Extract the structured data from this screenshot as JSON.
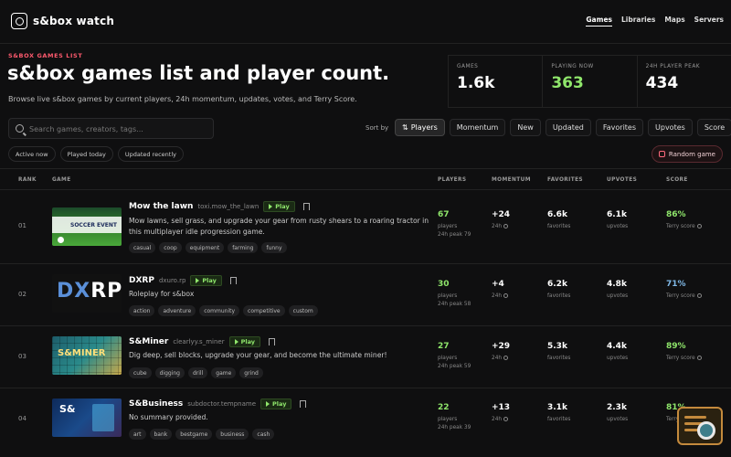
{
  "nav": {
    "brand": "s&box watch",
    "links": [
      "Games",
      "Libraries",
      "Maps",
      "Servers"
    ]
  },
  "hero": {
    "eyebrow": "S&BOX GAMES LIST",
    "title": "s&box games list and player count.",
    "subtitle": "Browse live s&box games by current players, 24h momentum, updates, votes, and Terry Score."
  },
  "stats": [
    {
      "label": "GAMES",
      "value": "1.6k"
    },
    {
      "label": "PLAYING NOW",
      "value": "363"
    },
    {
      "label": "24H PLAYER PEAK",
      "value": "434"
    }
  ],
  "search": {
    "placeholder": "Search games, creators, tags..."
  },
  "sort": {
    "label": "Sort by",
    "options": [
      "Players",
      "Momentum",
      "New",
      "Updated",
      "Favorites",
      "Upvotes",
      "Score"
    ],
    "active": "Players"
  },
  "filters": [
    "Active now",
    "Played today",
    "Updated recently"
  ],
  "random_label": "Random game",
  "columns": [
    "RANK",
    "GAME",
    "PLAYERS",
    "MOMENTUM",
    "FAVORITES",
    "UPVOTES",
    "SCORE"
  ],
  "rows": [
    {
      "rank": "01",
      "name": "Mow the lawn",
      "slug": "toxi.mow_the_lawn",
      "play": "Play",
      "thumb_text": "SOCCER EVENT",
      "desc": "Mow lawns, sell grass, and upgrade your gear from rusty shears to a roaring tractor in this multiplayer idle progression game.",
      "tags": [
        "casual",
        "coop",
        "equipment",
        "farming",
        "funny"
      ],
      "players": "67",
      "players_label": "players",
      "peak": "24h peak 79",
      "momentum": "+24",
      "momentum_label": "24h",
      "favorites": "6.6k",
      "favorites_label": "favorites",
      "upvotes": "6.1k",
      "upvotes_label": "upvotes",
      "score": "86%",
      "score_label": "Terry score",
      "score_color": "#8fe66b"
    },
    {
      "rank": "02",
      "name": "DXRP",
      "slug": "dxuro.rp",
      "play": "Play",
      "thumb_text": "DXRP",
      "desc": "Roleplay for s&box",
      "tags": [
        "action",
        "adventure",
        "community",
        "competitive",
        "custom"
      ],
      "players": "30",
      "players_label": "players",
      "peak": "24h peak 58",
      "momentum": "+4",
      "momentum_label": "24h",
      "favorites": "6.2k",
      "favorites_label": "favorites",
      "upvotes": "4.8k",
      "upvotes_label": "upvotes",
      "score": "71%",
      "score_label": "Terry score",
      "score_color": "#7fb8e6"
    },
    {
      "rank": "03",
      "name": "S&Miner",
      "slug": "clearlyy.s_miner",
      "play": "Play",
      "thumb_text": "S&MINER",
      "desc": "Dig deep, sell blocks, upgrade your gear, and become the ultimate miner!",
      "tags": [
        "cube",
        "digging",
        "drill",
        "game",
        "grind"
      ],
      "players": "27",
      "players_label": "players",
      "peak": "24h peak 59",
      "momentum": "+29",
      "momentum_label": "24h",
      "favorites": "5.3k",
      "favorites_label": "favorites",
      "upvotes": "4.4k",
      "upvotes_label": "upvotes",
      "score": "89%",
      "score_label": "Terry score",
      "score_color": "#8fe66b"
    },
    {
      "rank": "04",
      "name": "S&Business",
      "slug": "subdoctor.tempname",
      "play": "Play",
      "thumb_text": "S&",
      "desc": "No summary provided.",
      "tags": [
        "art",
        "bank",
        "bestgame",
        "business",
        "cash"
      ],
      "players": "22",
      "players_label": "players",
      "peak": "24h peak 39",
      "momentum": "+13",
      "momentum_label": "24h",
      "favorites": "3.1k",
      "favorites_label": "favorites",
      "upvotes": "2.3k",
      "upvotes_label": "upvotes",
      "score": "81%",
      "score_label": "Terry score",
      "score_color": "#8fe66b"
    }
  ]
}
